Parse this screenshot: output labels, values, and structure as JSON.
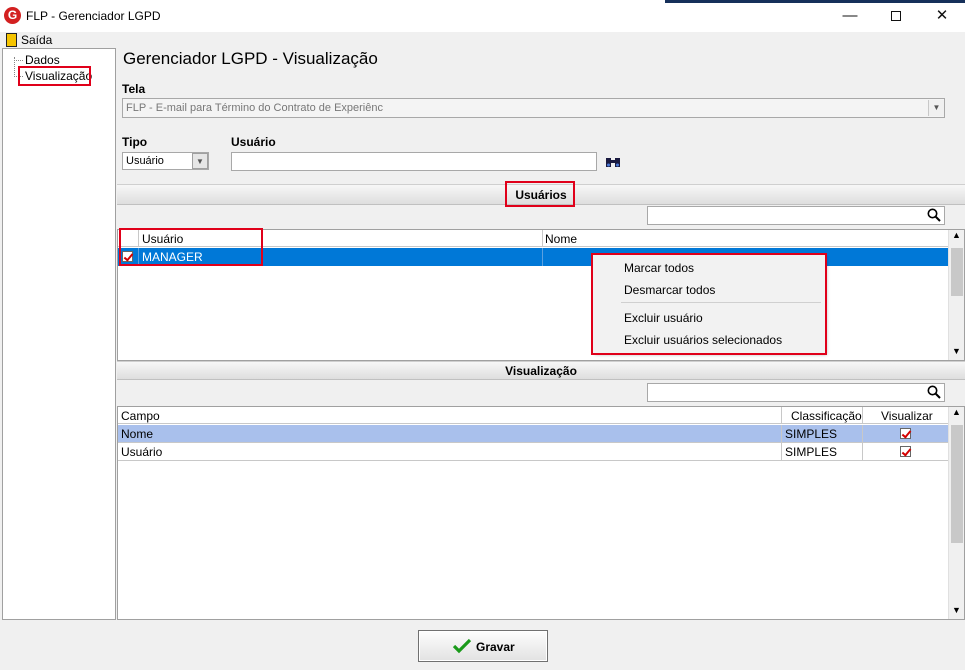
{
  "window": {
    "title": "FLP - Gerenciador LGPD",
    "app_icon_letter": "G"
  },
  "menu": {
    "exit_label": "Saída"
  },
  "tree": {
    "items": [
      {
        "label": "Dados"
      },
      {
        "label": "Visualização"
      }
    ]
  },
  "page": {
    "title": "Gerenciador LGPD - Visualização"
  },
  "tela": {
    "label": "Tela",
    "value": "FLP - E-mail para Término do Contrato de Experiênc"
  },
  "tipo": {
    "label": "Tipo",
    "value": "Usuário"
  },
  "usuario": {
    "label": "Usuário",
    "value": ""
  },
  "users_section": {
    "title": "Usuários",
    "search_value": "",
    "columns": [
      "Usuário",
      "Nome"
    ],
    "rows": [
      {
        "checked": true,
        "user": "MANAGER",
        "name": ""
      }
    ]
  },
  "context_menu": {
    "items": [
      "Marcar todos",
      "Desmarcar todos",
      "Excluir usuário",
      "Excluir usuários selecionados"
    ]
  },
  "view_section": {
    "title": "Visualização",
    "search_value": "",
    "columns": [
      "Campo",
      "Classificação",
      "Visualizar"
    ],
    "rows": [
      {
        "field": "Nome",
        "classification": "SIMPLES",
        "visible": true
      },
      {
        "field": "Usuário",
        "classification": "SIMPLES",
        "visible": true
      }
    ]
  },
  "footer": {
    "save_label": "Gravar"
  },
  "colors": {
    "selection_blue": "#0078d7",
    "row_highlight": "#a9c0ec",
    "highlight_red": "#e0001a",
    "brand_red": "#d32020"
  }
}
